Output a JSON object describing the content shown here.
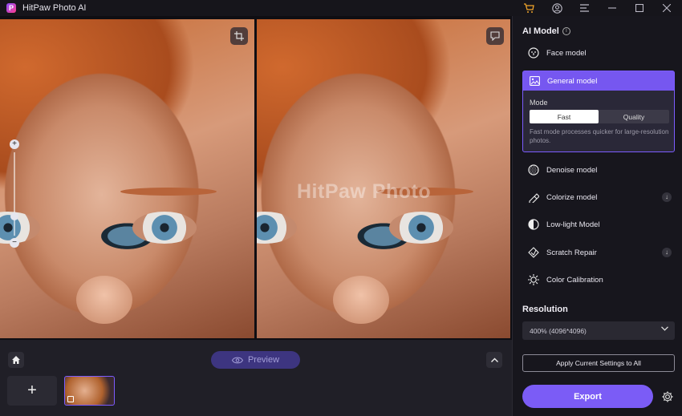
{
  "app": {
    "title": "HitPaw Photo AI",
    "logo_letter": "P"
  },
  "titlebar": {
    "icons": [
      "cart-icon",
      "account-icon",
      "menu-icon",
      "minimize-icon",
      "maximize-icon",
      "close-icon"
    ]
  },
  "canvas": {
    "watermark": "HitPaw Photo",
    "zoom": {
      "plus": "+",
      "minus": "−"
    }
  },
  "bottom": {
    "preview_label": "Preview",
    "add_label": "+"
  },
  "panel": {
    "ai_model_title": "AI Model",
    "models": [
      {
        "label": "Face model",
        "icon": "face-icon"
      },
      {
        "label": "General model",
        "icon": "image-icon",
        "selected": true
      },
      {
        "label": "Denoise model",
        "icon": "denoise-icon"
      },
      {
        "label": "Colorize model",
        "icon": "colorize-icon",
        "download": true
      },
      {
        "label": "Low-light Model",
        "icon": "low-light-icon"
      },
      {
        "label": "Scratch Repair",
        "icon": "scratch-repair-icon",
        "download": true
      },
      {
        "label": "Color Calibration",
        "icon": "color-calibration-icon"
      }
    ],
    "mode": {
      "label": "Mode",
      "options": [
        "Fast",
        "Quality"
      ],
      "selected": "Fast",
      "description": "Fast mode processes quicker for large-resolution photos."
    },
    "resolution_title": "Resolution",
    "resolution_value": "400% (4096*4096)",
    "apply_label": "Apply Current Settings to All",
    "export_label": "Export"
  },
  "colors": {
    "accent": "#7b5cf6",
    "selected_header": "#7657f0",
    "background": "#1b1a21"
  }
}
